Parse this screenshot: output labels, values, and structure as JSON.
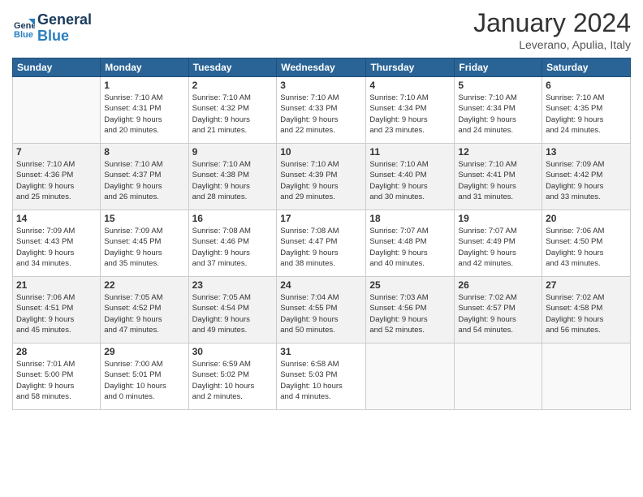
{
  "header": {
    "logo_line1": "General",
    "logo_line2": "Blue",
    "month": "January 2024",
    "location": "Leverano, Apulia, Italy"
  },
  "weekdays": [
    "Sunday",
    "Monday",
    "Tuesday",
    "Wednesday",
    "Thursday",
    "Friday",
    "Saturday"
  ],
  "weeks": [
    [
      {
        "day": "",
        "info": ""
      },
      {
        "day": "1",
        "info": "Sunrise: 7:10 AM\nSunset: 4:31 PM\nDaylight: 9 hours\nand 20 minutes."
      },
      {
        "day": "2",
        "info": "Sunrise: 7:10 AM\nSunset: 4:32 PM\nDaylight: 9 hours\nand 21 minutes."
      },
      {
        "day": "3",
        "info": "Sunrise: 7:10 AM\nSunset: 4:33 PM\nDaylight: 9 hours\nand 22 minutes."
      },
      {
        "day": "4",
        "info": "Sunrise: 7:10 AM\nSunset: 4:34 PM\nDaylight: 9 hours\nand 23 minutes."
      },
      {
        "day": "5",
        "info": "Sunrise: 7:10 AM\nSunset: 4:34 PM\nDaylight: 9 hours\nand 24 minutes."
      },
      {
        "day": "6",
        "info": "Sunrise: 7:10 AM\nSunset: 4:35 PM\nDaylight: 9 hours\nand 24 minutes."
      }
    ],
    [
      {
        "day": "7",
        "info": "Sunrise: 7:10 AM\nSunset: 4:36 PM\nDaylight: 9 hours\nand 25 minutes."
      },
      {
        "day": "8",
        "info": "Sunrise: 7:10 AM\nSunset: 4:37 PM\nDaylight: 9 hours\nand 26 minutes."
      },
      {
        "day": "9",
        "info": "Sunrise: 7:10 AM\nSunset: 4:38 PM\nDaylight: 9 hours\nand 28 minutes."
      },
      {
        "day": "10",
        "info": "Sunrise: 7:10 AM\nSunset: 4:39 PM\nDaylight: 9 hours\nand 29 minutes."
      },
      {
        "day": "11",
        "info": "Sunrise: 7:10 AM\nSunset: 4:40 PM\nDaylight: 9 hours\nand 30 minutes."
      },
      {
        "day": "12",
        "info": "Sunrise: 7:10 AM\nSunset: 4:41 PM\nDaylight: 9 hours\nand 31 minutes."
      },
      {
        "day": "13",
        "info": "Sunrise: 7:09 AM\nSunset: 4:42 PM\nDaylight: 9 hours\nand 33 minutes."
      }
    ],
    [
      {
        "day": "14",
        "info": "Sunrise: 7:09 AM\nSunset: 4:43 PM\nDaylight: 9 hours\nand 34 minutes."
      },
      {
        "day": "15",
        "info": "Sunrise: 7:09 AM\nSunset: 4:45 PM\nDaylight: 9 hours\nand 35 minutes."
      },
      {
        "day": "16",
        "info": "Sunrise: 7:08 AM\nSunset: 4:46 PM\nDaylight: 9 hours\nand 37 minutes."
      },
      {
        "day": "17",
        "info": "Sunrise: 7:08 AM\nSunset: 4:47 PM\nDaylight: 9 hours\nand 38 minutes."
      },
      {
        "day": "18",
        "info": "Sunrise: 7:07 AM\nSunset: 4:48 PM\nDaylight: 9 hours\nand 40 minutes."
      },
      {
        "day": "19",
        "info": "Sunrise: 7:07 AM\nSunset: 4:49 PM\nDaylight: 9 hours\nand 42 minutes."
      },
      {
        "day": "20",
        "info": "Sunrise: 7:06 AM\nSunset: 4:50 PM\nDaylight: 9 hours\nand 43 minutes."
      }
    ],
    [
      {
        "day": "21",
        "info": "Sunrise: 7:06 AM\nSunset: 4:51 PM\nDaylight: 9 hours\nand 45 minutes."
      },
      {
        "day": "22",
        "info": "Sunrise: 7:05 AM\nSunset: 4:52 PM\nDaylight: 9 hours\nand 47 minutes."
      },
      {
        "day": "23",
        "info": "Sunrise: 7:05 AM\nSunset: 4:54 PM\nDaylight: 9 hours\nand 49 minutes."
      },
      {
        "day": "24",
        "info": "Sunrise: 7:04 AM\nSunset: 4:55 PM\nDaylight: 9 hours\nand 50 minutes."
      },
      {
        "day": "25",
        "info": "Sunrise: 7:03 AM\nSunset: 4:56 PM\nDaylight: 9 hours\nand 52 minutes."
      },
      {
        "day": "26",
        "info": "Sunrise: 7:02 AM\nSunset: 4:57 PM\nDaylight: 9 hours\nand 54 minutes."
      },
      {
        "day": "27",
        "info": "Sunrise: 7:02 AM\nSunset: 4:58 PM\nDaylight: 9 hours\nand 56 minutes."
      }
    ],
    [
      {
        "day": "28",
        "info": "Sunrise: 7:01 AM\nSunset: 5:00 PM\nDaylight: 9 hours\nand 58 minutes."
      },
      {
        "day": "29",
        "info": "Sunrise: 7:00 AM\nSunset: 5:01 PM\nDaylight: 10 hours\nand 0 minutes."
      },
      {
        "day": "30",
        "info": "Sunrise: 6:59 AM\nSunset: 5:02 PM\nDaylight: 10 hours\nand 2 minutes."
      },
      {
        "day": "31",
        "info": "Sunrise: 6:58 AM\nSunset: 5:03 PM\nDaylight: 10 hours\nand 4 minutes."
      },
      {
        "day": "",
        "info": ""
      },
      {
        "day": "",
        "info": ""
      },
      {
        "day": "",
        "info": ""
      }
    ]
  ]
}
